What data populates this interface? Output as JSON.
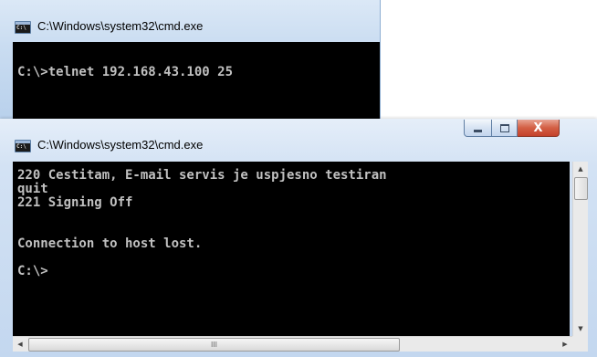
{
  "back_window": {
    "title": "C:\\Windows\\system32\\cmd.exe",
    "lines": [
      "C:\\>telnet 192.168.43.100 25"
    ]
  },
  "front_window": {
    "title": "C:\\Windows\\system32\\cmd.exe",
    "controls": {
      "minimize": "—",
      "maximize": "□",
      "close": "X"
    },
    "lines": [
      "220 Cestitam, E-mail servis je uspjesno testiran",
      "quit",
      "221 Signing Off",
      "",
      "",
      "Connection to host lost.",
      "",
      "C:\\>"
    ],
    "scrollbars": {
      "up": "▲",
      "down": "▼",
      "left": "◀",
      "right": "▶",
      "grip": "III"
    }
  },
  "icons": [
    "cmd-icon",
    "minimize-icon",
    "maximize-icon",
    "close-icon"
  ]
}
